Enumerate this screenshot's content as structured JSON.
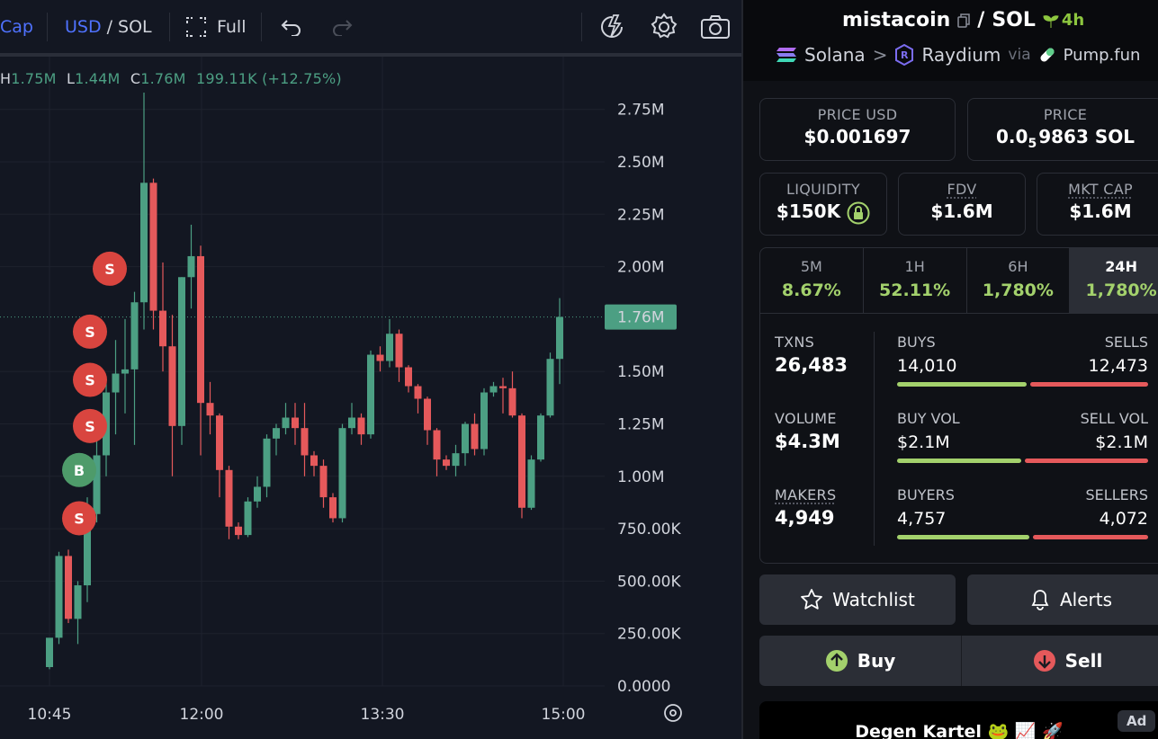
{
  "toolbar": {
    "cap_label": "Cap",
    "currency_usd": "USD",
    "currency_sep": "/",
    "currency_sol": "SOL",
    "full_label": "Full"
  },
  "ohlc": {
    "h_key": "H",
    "h_val": "1.75M",
    "l_key": "L",
    "l_val": "1.44M",
    "c_key": "C",
    "c_val": "1.76M",
    "change": "199.11K (+12.75%)"
  },
  "chart_data": {
    "type": "candlestick",
    "y_ticks": [
      "2.75M",
      "2.50M",
      "2.25M",
      "2.00M",
      "1.50M",
      "1.25M",
      "1.00M",
      "750.00K",
      "500.00K",
      "250.00K",
      "0.0000"
    ],
    "y_tick_values": [
      2750000,
      2500000,
      2250000,
      2000000,
      1500000,
      1250000,
      1000000,
      750000,
      500000,
      250000,
      0
    ],
    "x_ticks": [
      "10:45",
      "12:00",
      "13:30",
      "15:00"
    ],
    "current_price_label": "1.76M",
    "current_price": 1760000,
    "colors": {
      "up": "#4c9f83",
      "down": "#e5595b",
      "sell_marker": "#d9453f",
      "buy_marker": "#4e9b6a"
    },
    "candles": [
      {
        "o": 90000,
        "h": 220000,
        "c": 230000,
        "l": 80000
      },
      {
        "o": 230000,
        "h": 640000,
        "c": 620000,
        "l": 200000
      },
      {
        "o": 620000,
        "h": 650000,
        "c": 320000,
        "l": 300000
      },
      {
        "o": 320000,
        "h": 500000,
        "c": 480000,
        "l": 200000
      },
      {
        "o": 480000,
        "h": 900000,
        "c": 820000,
        "l": 400000
      },
      {
        "o": 820000,
        "h": 1200000,
        "c": 1100000,
        "l": 780000
      },
      {
        "o": 1100000,
        "h": 1450000,
        "c": 1400000,
        "l": 1000000
      },
      {
        "o": 1400000,
        "h": 1650000,
        "c": 1490000,
        "l": 1200000
      },
      {
        "o": 1490000,
        "h": 1750000,
        "c": 1510000,
        "l": 1300000
      },
      {
        "o": 1510000,
        "h": 1880000,
        "c": 1830000,
        "l": 1150000
      },
      {
        "o": 1830000,
        "h": 2830000,
        "c": 2400000,
        "l": 1700000
      },
      {
        "o": 2400000,
        "h": 2420000,
        "c": 1790000,
        "l": 1700000
      },
      {
        "o": 1790000,
        "h": 2020000,
        "c": 1620000,
        "l": 1500000
      },
      {
        "o": 1620000,
        "h": 1770000,
        "c": 1240000,
        "l": 1000000
      },
      {
        "o": 1240000,
        "h": 1950000,
        "c": 1950000,
        "l": 1150000
      },
      {
        "o": 1950000,
        "h": 2200000,
        "c": 2050000,
        "l": 1800000
      },
      {
        "o": 2050000,
        "h": 2100000,
        "c": 1350000,
        "l": 1100000
      },
      {
        "o": 1350000,
        "h": 1450000,
        "c": 1290000,
        "l": 1200000
      },
      {
        "o": 1290000,
        "h": 1300000,
        "c": 1030000,
        "l": 900000
      },
      {
        "o": 1030000,
        "h": 1050000,
        "c": 760000,
        "l": 700000
      },
      {
        "o": 760000,
        "h": 780000,
        "c": 720000,
        "l": 700000
      },
      {
        "o": 720000,
        "h": 900000,
        "c": 880000,
        "l": 710000
      },
      {
        "o": 880000,
        "h": 1000000,
        "c": 950000,
        "l": 850000
      },
      {
        "o": 950000,
        "h": 1200000,
        "c": 1180000,
        "l": 900000
      },
      {
        "o": 1180000,
        "h": 1250000,
        "c": 1230000,
        "l": 1100000
      },
      {
        "o": 1230000,
        "h": 1350000,
        "c": 1280000,
        "l": 1200000
      },
      {
        "o": 1280000,
        "h": 1350000,
        "c": 1230000,
        "l": 1150000
      },
      {
        "o": 1230000,
        "h": 1350000,
        "c": 1100000,
        "l": 1000000
      },
      {
        "o": 1100000,
        "h": 1120000,
        "c": 1050000,
        "l": 1000000
      },
      {
        "o": 1050000,
        "h": 1080000,
        "c": 900000,
        "l": 850000
      },
      {
        "o": 900000,
        "h": 920000,
        "c": 800000,
        "l": 780000
      },
      {
        "o": 800000,
        "h": 1250000,
        "c": 1230000,
        "l": 780000
      },
      {
        "o": 1230000,
        "h": 1350000,
        "c": 1280000,
        "l": 1200000
      },
      {
        "o": 1280000,
        "h": 1300000,
        "c": 1200000,
        "l": 1150000
      },
      {
        "o": 1200000,
        "h": 1600000,
        "c": 1580000,
        "l": 1180000
      },
      {
        "o": 1580000,
        "h": 1620000,
        "c": 1550000,
        "l": 1500000
      },
      {
        "o": 1550000,
        "h": 1750000,
        "c": 1680000,
        "l": 1520000
      },
      {
        "o": 1680000,
        "h": 1700000,
        "c": 1520000,
        "l": 1450000
      },
      {
        "o": 1520000,
        "h": 1530000,
        "c": 1430000,
        "l": 1400000
      },
      {
        "o": 1430000,
        "h": 1440000,
        "c": 1370000,
        "l": 1300000
      },
      {
        "o": 1370000,
        "h": 1380000,
        "c": 1220000,
        "l": 1150000
      },
      {
        "o": 1220000,
        "h": 1230000,
        "c": 1080000,
        "l": 1000000
      },
      {
        "o": 1080000,
        "h": 1100000,
        "c": 1050000,
        "l": 1030000
      },
      {
        "o": 1050000,
        "h": 1150000,
        "c": 1110000,
        "l": 1000000
      },
      {
        "o": 1110000,
        "h": 1260000,
        "c": 1250000,
        "l": 1050000
      },
      {
        "o": 1250000,
        "h": 1300000,
        "c": 1130000,
        "l": 1100000
      },
      {
        "o": 1130000,
        "h": 1420000,
        "c": 1400000,
        "l": 1100000
      },
      {
        "o": 1400000,
        "h": 1450000,
        "c": 1430000,
        "l": 1380000
      },
      {
        "o": 1430000,
        "h": 1470000,
        "c": 1420000,
        "l": 1300000
      },
      {
        "o": 1420000,
        "h": 1500000,
        "c": 1290000,
        "l": 1280000
      },
      {
        "o": 1290000,
        "h": 1300000,
        "c": 850000,
        "l": 800000
      },
      {
        "o": 850000,
        "h": 1100000,
        "c": 1080000,
        "l": 840000
      },
      {
        "o": 1080000,
        "h": 1300000,
        "c": 1290000,
        "l": 1070000
      },
      {
        "o": 1290000,
        "h": 1590000,
        "c": 1560000,
        "l": 1280000
      },
      {
        "o": 1560000,
        "h": 1850000,
        "c": 1760000,
        "l": 1440000
      }
    ],
    "trade_markers": [
      {
        "label": "S",
        "type": "sell",
        "price": 1990000
      },
      {
        "label": "S",
        "type": "sell",
        "price": 1690000
      },
      {
        "label": "S",
        "type": "sell",
        "price": 1460000
      },
      {
        "label": "S",
        "type": "sell",
        "price": 1240000
      },
      {
        "label": "B",
        "type": "buy",
        "price": 1030000
      },
      {
        "label": "S",
        "type": "sell",
        "price": 800000
      }
    ]
  },
  "pair": {
    "token": "mistacoin",
    "slash": "/",
    "quote": "SOL",
    "age": "4h",
    "chain": "Solana",
    "chevron": ">",
    "dex": "Raydium",
    "via": "via",
    "launchpad": "Pump.fun"
  },
  "stats": {
    "price_usd_label": "PRICE USD",
    "price_usd": "$0.001697",
    "price_label": "PRICE",
    "price_sol_prefix": "0.0",
    "price_sol_sub": "5",
    "price_sol_rest": "9863 SOL",
    "liquidity_label": "LIQUIDITY",
    "liquidity": "$150K",
    "fdv_label": "FDV",
    "fdv": "$1.6M",
    "mktcap_label": "MKT CAP",
    "mktcap": "$1.6M"
  },
  "timeframes": [
    {
      "name": "5M",
      "pct": "8.67%"
    },
    {
      "name": "1H",
      "pct": "52.11%"
    },
    {
      "name": "6H",
      "pct": "1,780%"
    },
    {
      "name": "24H",
      "pct": "1,780%"
    }
  ],
  "txn": {
    "txns_label": "TXNS",
    "txns": "26,483",
    "volume_label": "VOLUME",
    "volume": "$4.3M",
    "makers_label": "MAKERS",
    "makers": "4,949",
    "buys_label": "BUYS",
    "buys": "14,010",
    "sells_label": "SELLS",
    "sells": "12,473",
    "buyvol_label": "BUY VOL",
    "buyvol": "$2.1M",
    "sellvol_label": "SELL VOL",
    "sellvol": "$2.1M",
    "buyers_label": "BUYERS",
    "buyers": "4,757",
    "sellers_label": "SELLERS",
    "sellers": "4,072"
  },
  "actions": {
    "watchlist": "Watchlist",
    "alerts": "Alerts",
    "buy": "Buy",
    "sell": "Sell"
  },
  "ad": {
    "title": "Degen Kartel 🐸 📈 🚀",
    "badge": "Ad"
  }
}
